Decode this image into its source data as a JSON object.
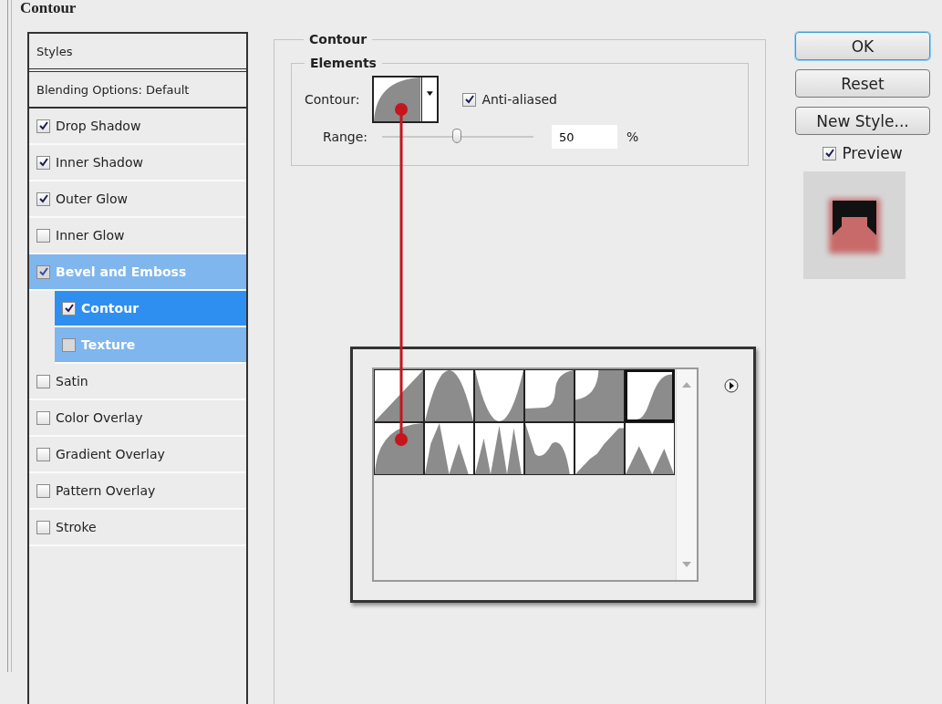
{
  "heading": "Contour",
  "styles_panel": {
    "title": "Styles",
    "blending": "Blending Options: Default",
    "items": [
      {
        "label": "Drop Shadow",
        "checked": true,
        "selected": false
      },
      {
        "label": "Inner Shadow",
        "checked": true,
        "selected": false
      },
      {
        "label": "Outer Glow",
        "checked": true,
        "selected": false
      },
      {
        "label": "Inner Glow",
        "checked": false,
        "selected": false
      },
      {
        "label": "Bevel and Emboss",
        "checked": true,
        "selected": false,
        "children": [
          {
            "label": "Contour",
            "checked": true,
            "selected": true
          },
          {
            "label": "Texture",
            "checked": false,
            "selected": false
          }
        ]
      },
      {
        "label": "Satin",
        "checked": false,
        "selected": false
      },
      {
        "label": "Color Overlay",
        "checked": false,
        "selected": false
      },
      {
        "label": "Gradient Overlay",
        "checked": false,
        "selected": false
      },
      {
        "label": "Pattern Overlay",
        "checked": false,
        "selected": false
      },
      {
        "label": "Stroke",
        "checked": false,
        "selected": false
      }
    ]
  },
  "contour_group": {
    "title": "Contour",
    "elements": {
      "title": "Elements",
      "contour_label": "Contour:",
      "anti_aliased": {
        "label": "Anti-aliased",
        "checked": true
      },
      "range": {
        "label": "Range:",
        "level": 0.5,
        "value": "50",
        "unit": "%"
      }
    }
  },
  "contour_picker": {
    "presets": [
      {
        "selected": false
      },
      {
        "selected": false
      },
      {
        "selected": false
      },
      {
        "selected": false
      },
      {
        "selected": false
      },
      {
        "selected": true
      },
      {
        "selected": false
      },
      {
        "selected": false
      },
      {
        "selected": false
      },
      {
        "selected": false
      },
      {
        "selected": false
      },
      {
        "selected": false
      }
    ]
  },
  "buttons": [
    "OK",
    "Reset",
    "New Style..."
  ],
  "preview": {
    "label": "Preview",
    "checked": true
  }
}
